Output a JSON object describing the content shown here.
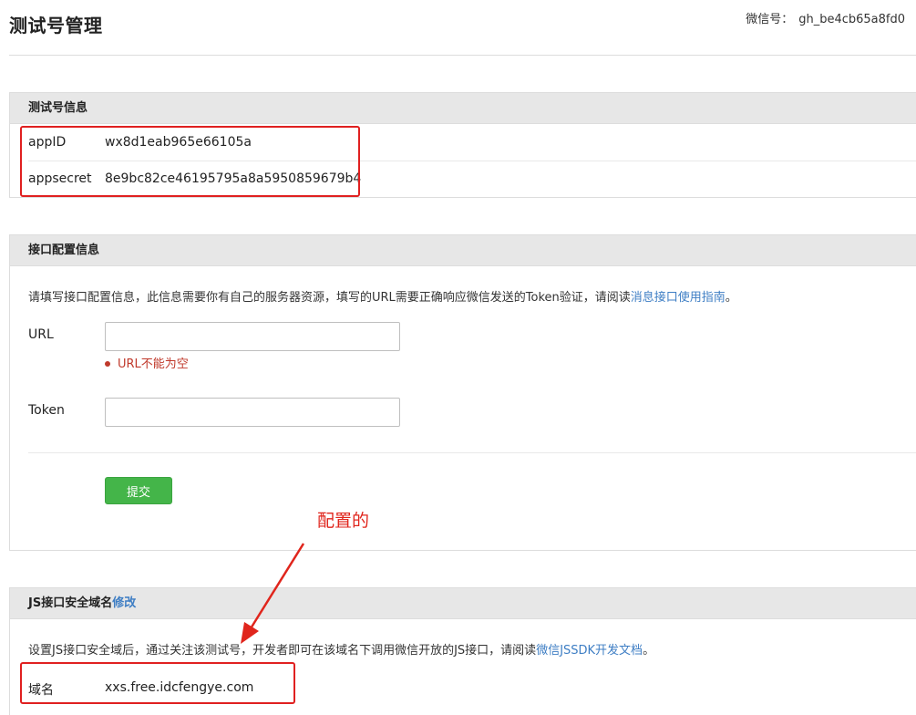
{
  "header": {
    "title": "测试号管理",
    "wechat_id_label": "微信号：",
    "wechat_id_value": "gh_be4cb65a8fd0"
  },
  "test_account": {
    "heading": "测试号信息",
    "app_id_label": "appID",
    "app_id_value": "wx8d1eab965e66105a",
    "app_secret_label": "appsecret",
    "app_secret_value": "8e9bc82ce46195795a8a5950859679b4"
  },
  "interface_config": {
    "heading": "接口配置信息",
    "desc_text": "请填写接口配置信息，此信息需要你有自己的服务器资源，填写的URL需要正确响应微信发送的Token验证，请阅读",
    "desc_link": "消息接口使用指南",
    "desc_end": "。",
    "url_label": "URL",
    "url_value": "",
    "url_error": "URL不能为空",
    "token_label": "Token",
    "token_value": "",
    "submit_label": "提交"
  },
  "js_domain": {
    "heading": "JS接口安全域名",
    "edit_link": "修改",
    "desc_text": "设置JS接口安全域后，通过关注该测试号，开发者即可在该域名下调用微信开放的JS接口，请阅读",
    "desc_link": "微信JSSDK开发文档",
    "desc_end": "。",
    "domain_label": "域名",
    "domain_value": "xxs.free.idcfengye.com"
  },
  "annotation": {
    "text": "配置的",
    "color": "#e0251c"
  },
  "colors": {
    "link": "#3e7ec4",
    "submit": "#44b549",
    "error": "#c0392b",
    "highlight_box": "#e02020"
  }
}
